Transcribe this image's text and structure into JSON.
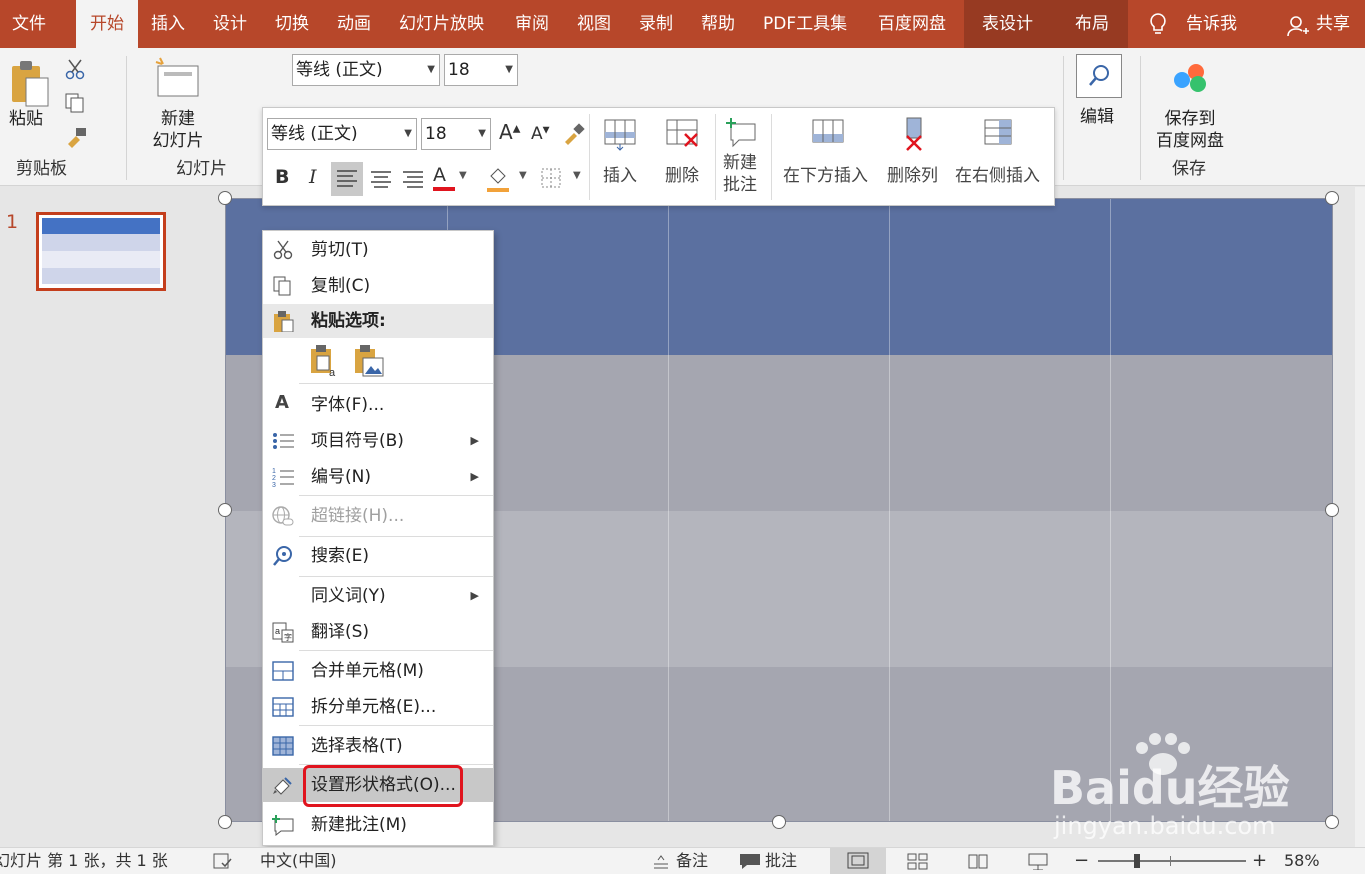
{
  "tabs": [
    "文件",
    "开始",
    "插入",
    "设计",
    "切换",
    "动画",
    "幻灯片放映",
    "审阅",
    "视图",
    "录制",
    "帮助",
    "PDF工具集",
    "百度网盘",
    "表设计",
    "布局"
  ],
  "tell_me": "告诉我",
  "share": "共享",
  "ribbon": {
    "paste": "粘贴",
    "clipboard": "剪贴板",
    "new_slide": [
      "新建",
      "幻灯片"
    ],
    "slides": "幻灯片",
    "font_name": "等线 (正文)",
    "font_size": "18",
    "edit": "编辑",
    "save_to": [
      "保存到",
      "百度网盘"
    ],
    "save": "保存"
  },
  "mini_toolbar": {
    "font_name": "等线 (正文)",
    "font_size": "18",
    "insert": "插入",
    "delete": "删除",
    "new_comment": [
      "新建",
      "批注"
    ],
    "insert_below": "在下方插入",
    "delete_col": "删除列",
    "insert_right": "在右侧插入"
  },
  "slide_number": "1",
  "context_menu": {
    "cut": "剪切(T)",
    "copy": "复制(C)",
    "paste_options": "粘贴选项:",
    "font": "字体(F)...",
    "bullets": "项目符号(B)",
    "numbering": "编号(N)",
    "hyperlink": "超链接(H)...",
    "search": "搜索(E)",
    "synonyms": "同义词(Y)",
    "translate": "翻译(S)",
    "merge_cells": "合并单元格(M)",
    "split_cells": "拆分单元格(E)...",
    "select_table": "选择表格(T)",
    "format_shape": "设置形状格式(O)...",
    "new_comment": "新建批注(M)"
  },
  "status": {
    "slide_info": "幻灯片 第 1 张，共 1 张",
    "language": "中文(中国)",
    "notes": "备注",
    "comments": "批注",
    "zoom_minus": "−",
    "zoom_plus": "+",
    "zoom": "58%"
  },
  "watermark": {
    "logo": "Baidu经验",
    "url": "jingyan.baidu.com"
  },
  "colors": {
    "accent": "#b7472a",
    "table_header": "#5b70a0",
    "table_band": "#a5a6b0",
    "highlight": "#e0141e"
  }
}
